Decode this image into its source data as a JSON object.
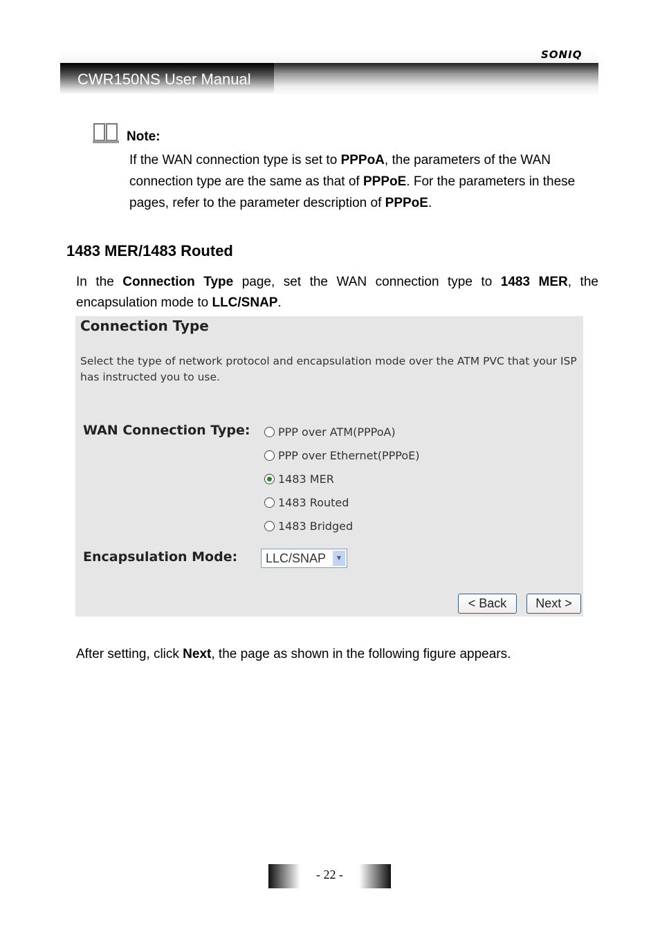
{
  "header": {
    "brand": "SONIQ",
    "title": "CWR150NS User Manual"
  },
  "note": {
    "icon": "book-icon",
    "label": "Note:",
    "text": [
      {
        "t": "If the WAN connection type is set to "
      },
      {
        "b": "PPPoA"
      },
      {
        "t": ", the parameters of the WAN connection type are the same as that of "
      },
      {
        "b": "PPPoE"
      },
      {
        "t": ". For the parameters in these pages, refer to the parameter description of "
      },
      {
        "b": "PPPoE"
      },
      {
        "t": "."
      }
    ]
  },
  "section": {
    "title": "1483 MER/1483 Routed",
    "intro": [
      {
        "t": "In the "
      },
      {
        "b": "Connection Type"
      },
      {
        "t": " page, set the WAN connection type to "
      },
      {
        "b": "1483 MER"
      },
      {
        "t": ", the encapsulation mode to "
      },
      {
        "b": "LLC/SNAP"
      },
      {
        "t": "."
      }
    ]
  },
  "screenshot": {
    "title": "Connection Type",
    "description": "Select the type of network protocol and encapsulation mode over the ATM PVC that your ISP has instructed you to use.",
    "wan_label": "WAN Connection Type:",
    "options": [
      {
        "label": "PPP over ATM(PPPoA)",
        "selected": false
      },
      {
        "label": "PPP over Ethernet(PPPoE)",
        "selected": false
      },
      {
        "label": "1483 MER",
        "selected": true
      },
      {
        "label": "1483 Routed",
        "selected": false
      },
      {
        "label": "1483 Bridged",
        "selected": false
      }
    ],
    "encap_label": "Encapsulation Mode:",
    "encap_value": "LLC/SNAP",
    "back": "< Back",
    "next": "Next >"
  },
  "after": [
    {
      "t": "After setting, click "
    },
    {
      "b": "Next"
    },
    {
      "t": ", the page as shown in the following figure appears."
    }
  ],
  "footer": {
    "page": "- 22 -"
  }
}
